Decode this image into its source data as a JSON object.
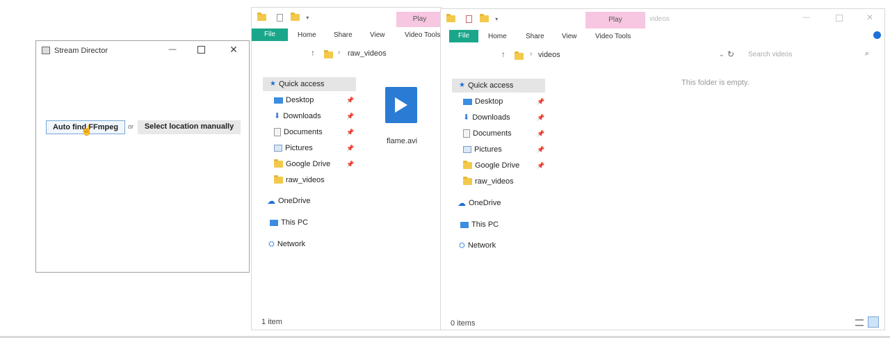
{
  "stream_director": {
    "title": "Stream Director",
    "auto_find_label": "Auto find FFmpeg",
    "or_label": "or",
    "manual_label": "Select location manually"
  },
  "explorer_left": {
    "context_tab": "Play",
    "tabs": [
      "File",
      "Home",
      "Share",
      "View",
      "Video Tools"
    ],
    "path": "raw_videos",
    "nav": {
      "quick_access": "Quick access",
      "items": [
        "Desktop",
        "Downloads",
        "Documents",
        "Pictures",
        "Google Drive",
        "raw_videos"
      ],
      "onedrive": "OneDrive",
      "this_pc": "This PC",
      "network": "Network"
    },
    "file_name": "flame.avi",
    "status": "1 item"
  },
  "explorer_right": {
    "context_tab": "Play",
    "title": "videos",
    "tabs": [
      "File",
      "Home",
      "Share",
      "View",
      "Video Tools"
    ],
    "path": "videos",
    "search_placeholder": "Search videos",
    "empty_message": "This folder is empty.",
    "nav": {
      "quick_access": "Quick access",
      "items": [
        "Desktop",
        "Downloads",
        "Documents",
        "Pictures",
        "Google Drive",
        "raw_videos"
      ],
      "onedrive": "OneDrive",
      "this_pc": "This PC",
      "network": "Network"
    },
    "status": "0 items"
  },
  "colors": {
    "file_tab": "#1aa68a",
    "context_tab": "#f7c6e0",
    "folder": "#f2c94c",
    "onedrive": "#1e6fd9"
  }
}
